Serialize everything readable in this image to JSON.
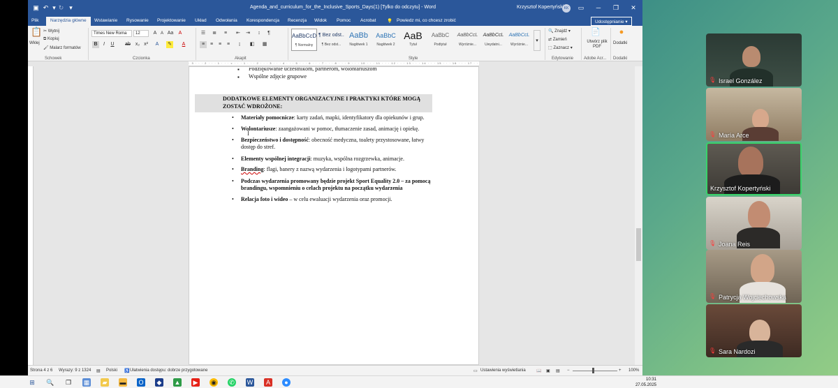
{
  "window": {
    "title": "Agenda_and_curriculum_for_the_Inclusive_Sports_Days(1) [Tylko do odczytu] - Word",
    "user": "Krzysztof Kopertyński",
    "user_initials": "KK"
  },
  "tabs": [
    "Plik",
    "Narzędzia główne",
    "Wstawianie",
    "Rysowanie",
    "Projektowanie",
    "Układ",
    "Odwołania",
    "Korespondencja",
    "Recenzja",
    "Widok",
    "Pomoc",
    "Acrobat"
  ],
  "tell_me": "Powiedz mi, co chcesz zrobić",
  "share_label": "Udostępnianie",
  "ribbon": {
    "clipboard": {
      "paste": "Wklej",
      "cut": "Wytnij",
      "copy": "Kopiuj",
      "format_painter": "Malarz formatów",
      "group": "Schowek"
    },
    "font": {
      "name": "Times New Roma",
      "size": "12",
      "group": "Czcionka"
    },
    "paragraph_group": "Akapit",
    "styles": [
      {
        "preview": "AaBbCcD",
        "name": "¶ Normalny"
      },
      {
        "preview": "¶ Bez odst...",
        "name": "¶ Bez odst..."
      },
      {
        "preview": "AaBb",
        "name": "Nagłówek 1"
      },
      {
        "preview": "AaBbC",
        "name": "Nagłówek 2"
      },
      {
        "preview": "AaB",
        "name": "Tytuł"
      },
      {
        "preview": "AaBbC",
        "name": "Podtytuł"
      },
      {
        "preview": "AaBbCcL",
        "name": "Wyróżnie..."
      },
      {
        "preview": "AaBbCcL",
        "name": "Uwydatni..."
      },
      {
        "preview": "AaBbCcL",
        "name": "Wyróżnie..."
      }
    ],
    "styles_group": "Style",
    "editing": {
      "find": "Znajdź",
      "replace": "Zamień",
      "select": "Zaznacz",
      "group": "Edytowanie"
    },
    "acrobat": {
      "create_pdf": "Utwórz plik PDF",
      "group": "Adobe Acr..."
    },
    "addins": {
      "label": "Dodatki",
      "group": "Dodatki"
    }
  },
  "document": {
    "top_lines": [
      "Podziękowanie uczestnikom, partnerom, wolontariuszom",
      "Wspólne zdjęcie grupowe"
    ],
    "heading_line1": "DODATKOWE ELEMENTY ORGANIZACYJNE I PRAKTYKI KTÓRE MOGĄ",
    "heading_line2": "ZOSTAĆ WDROŻONE:",
    "items": [
      {
        "bold": "Materiały pomocnicze",
        "rest": ": karty zadań, mapki, identyfikatory dla opiekunów i grup."
      },
      {
        "bold": "Wolontariusze",
        "rest": ": zaangażowani w pomoc, tłumaczenie zasad, animację i opiekę."
      },
      {
        "bold": "Bezpieczeństwo i dostępność",
        "rest": ": obecność medyczna, toalety przystosowane, łatwy",
        "line2": "dostęp do stref."
      },
      {
        "bold": "Elementy wspólnej integracji",
        "rest": ": muzyka, wspólna rozgrzewka, animacje."
      },
      {
        "bold": "Branding",
        "rest": ": flagi, banery z nazwą wydarzenia i logotypami partnerów."
      },
      {
        "bold": "Podczas wydarzenia promowany będzie projekt Sport Equality 2.0 – za pomocą",
        "rest": "",
        "line2": "brandingu, wspomnieniu o celach projektu na początku wydarzenia"
      },
      {
        "bold": "Relacja foto i wideo",
        "rest": " – w celu ewaluacji wydarzenia oraz promocji."
      }
    ]
  },
  "status": {
    "page": "Strona 4 z 6",
    "words": "Wyrazy: 9 z 1324",
    "language": "Polski",
    "accessibility": "Ułatwienia dostępu: dobrze przygotowane",
    "display": "Ustawienia wyświetlania",
    "zoom": "100%"
  },
  "participants": [
    {
      "name": "Israel González",
      "muted": true,
      "active": false
    },
    {
      "name": "María Arce",
      "muted": true,
      "active": false
    },
    {
      "name": "Krzysztof Kopertyński",
      "muted": false,
      "active": true
    },
    {
      "name": "Joana Reis",
      "muted": true,
      "active": false
    },
    {
      "name": "Patrycja Wojciechowska",
      "muted": true,
      "active": false
    },
    {
      "name": "Sara Nardozi",
      "muted": true,
      "active": false
    }
  ],
  "clock": {
    "time": "10:31",
    "date": "27.05.2025"
  },
  "colors": {
    "word_blue": "#2b579a",
    "active_tile": "#3ad36a",
    "muted_mic": "#ff3b3b"
  }
}
